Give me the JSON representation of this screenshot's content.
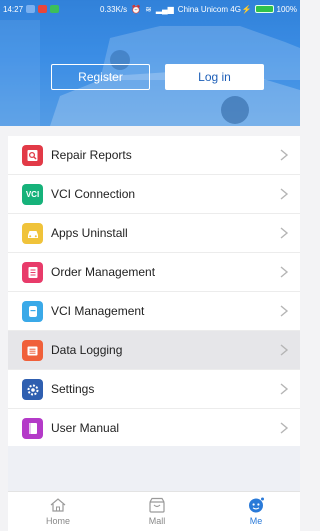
{
  "status_bar": {
    "time": "14:27",
    "network_speed": "0.33K/s",
    "carrier": "China Unicom 4G",
    "battery": "100%"
  },
  "header": {
    "register_label": "Register",
    "login_label": "Log in"
  },
  "menu": {
    "items": [
      {
        "label": "Repair Reports",
        "icon": "repair-report-icon",
        "color": "#e23a47"
      },
      {
        "label": "VCI Connection",
        "icon": "vci-icon",
        "icon_text": "VCI",
        "color": "#16b27a"
      },
      {
        "label": "Apps Uninstall",
        "icon": "car-icon",
        "color": "#f0c33a"
      },
      {
        "label": "Order Management",
        "icon": "order-icon",
        "color": "#e83b6a"
      },
      {
        "label": "VCI Management",
        "icon": "vci-management-icon",
        "color": "#3aa9e8"
      },
      {
        "label": "Data Logging",
        "icon": "data-logging-icon",
        "color": "#f0603a"
      },
      {
        "label": "Settings",
        "icon": "gear-icon",
        "color": "#2f5fb0"
      },
      {
        "label": "User Manual",
        "icon": "book-icon",
        "color": "#b43ac8"
      }
    ]
  },
  "tabbar": {
    "home": "Home",
    "mall": "Mall",
    "me": "Me"
  },
  "colors": {
    "accent": "#2a7ad8",
    "header_blue": "#3b8ee6",
    "selected_row": "#e6e6e9"
  }
}
